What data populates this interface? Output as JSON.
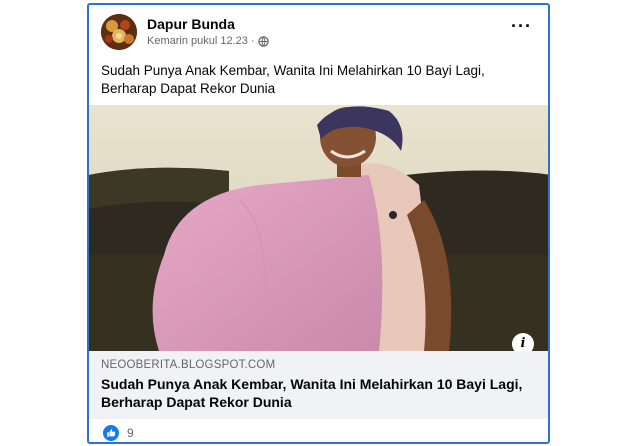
{
  "post": {
    "page_name": "Dapur Bunda",
    "timestamp": "Kemarin pukul 12.23",
    "separator": "·",
    "privacy_icon": "globe-icon",
    "more_icon": "more-icon",
    "text": "Sudah Punya Anak Kembar, Wanita Ini Melahirkan 10 Bayi Lagi, Berharap Dapat Rekor Dunia"
  },
  "link": {
    "domain": "NEOOBERITA.BLOGSPOT.COM",
    "title": "Sudah Punya Anak Kembar, Wanita Ini Melahirkan 10 Bayi Lagi, Berharap Dapat Rekor Dunia",
    "info_label": "i"
  },
  "reactions": {
    "icon": "like-icon",
    "count": "9"
  },
  "colors": {
    "frame_border": "#2d73c9",
    "like_blue": "#1877f2",
    "link_box_bg": "#f0f2f5",
    "secondary_text": "#65676b"
  }
}
